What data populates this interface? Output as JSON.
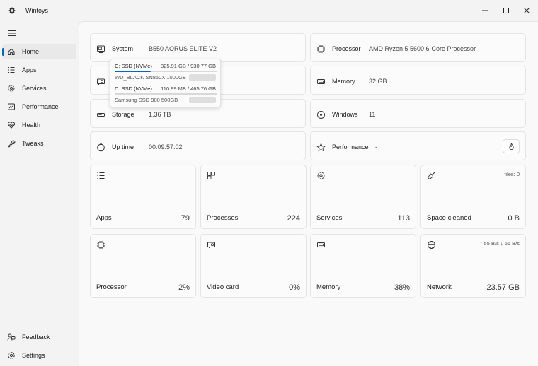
{
  "app": {
    "title": "Wintoys"
  },
  "sidebar": {
    "items": [
      {
        "label": "Home"
      },
      {
        "label": "Apps"
      },
      {
        "label": "Services"
      },
      {
        "label": "Performance"
      },
      {
        "label": "Health"
      },
      {
        "label": "Tweaks"
      }
    ],
    "footer": [
      {
        "label": "Feedback"
      },
      {
        "label": "Settings"
      }
    ]
  },
  "info": {
    "system": {
      "title": "System",
      "value": "B550 AORUS ELITE V2"
    },
    "processor": {
      "title": "Processor",
      "value": "AMD Ryzen 5 5600 6-Core Processor"
    },
    "memory": {
      "title": "Memory",
      "value": "32 GB"
    },
    "storage": {
      "title": "Storage",
      "value": "1.36 TB"
    },
    "windows": {
      "title": "Windows",
      "value": "11"
    },
    "uptime": {
      "title": "Up time",
      "value": "00:09:57:02"
    },
    "performance": {
      "title": "Performance",
      "value": "-"
    }
  },
  "storage_popup": {
    "drives": [
      {
        "name": "C: SSD (NVMe)",
        "usage": "325.91 GB / 930.77 GB",
        "model": "WD_BLACK SN850X 1000GB",
        "used_fraction": 0.35
      },
      {
        "name": "D: SSD (NVMe)",
        "usage": "110.99 MB / 465.76 GB",
        "model": "Samsung SSD 980 500GB",
        "used_fraction": 0.0002
      }
    ]
  },
  "tiles": [
    {
      "label": "Apps",
      "value": "79"
    },
    {
      "label": "Processes",
      "value": "224"
    },
    {
      "label": "Services",
      "value": "113"
    },
    {
      "label": "Space cleaned",
      "value": "0 B",
      "meta": "files: 0"
    },
    {
      "label": "Processor",
      "value": "2%"
    },
    {
      "label": "Video card",
      "value": "0%"
    },
    {
      "label": "Memory",
      "value": "38%"
    },
    {
      "label": "Network",
      "value": "23.57 GB",
      "meta": "↑ 55 B/s  ↓ 66 B/s"
    }
  ],
  "colors": {
    "accent": "#0067c0",
    "content_bg": "#f9f9f9",
    "window_bg": "#f3f3f3"
  }
}
